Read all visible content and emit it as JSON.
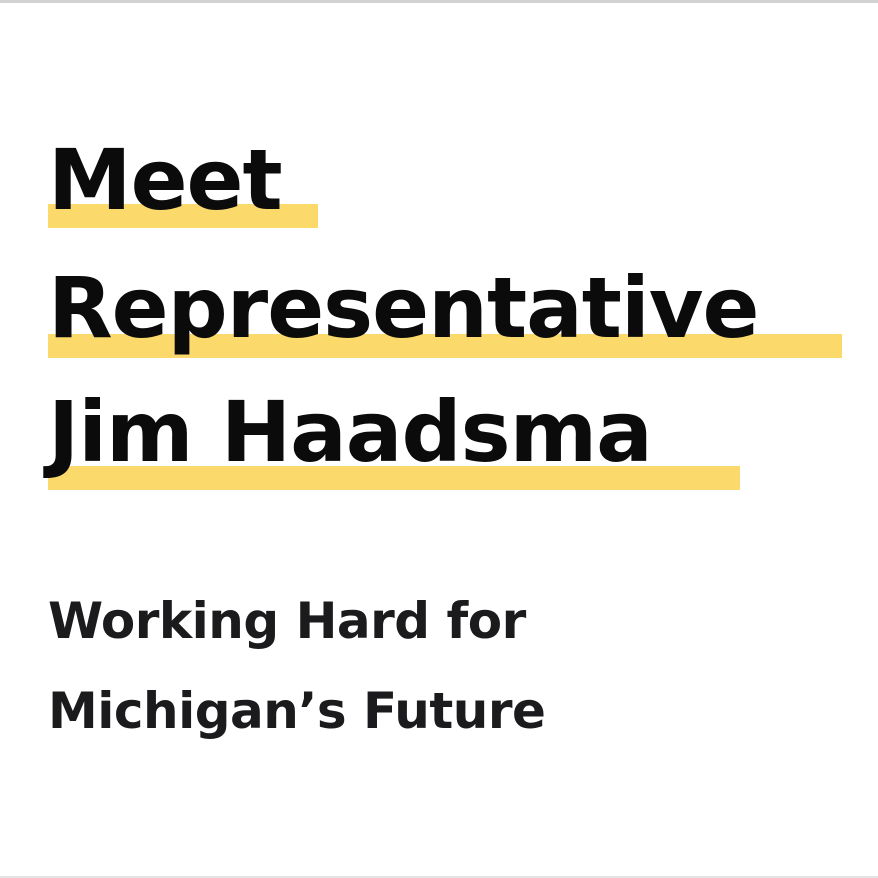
{
  "headline": {
    "line1": "Meet",
    "line2": "Representative",
    "line3": "Jim Haadsma"
  },
  "subheadline": {
    "line1": "Working Hard for",
    "line2": "Michigan’s Future"
  },
  "colors": {
    "highlight": "#fbd96b",
    "headline_text": "#0b0b0b",
    "subheadline_text": "#1b1b1d",
    "background": "#ffffff"
  }
}
